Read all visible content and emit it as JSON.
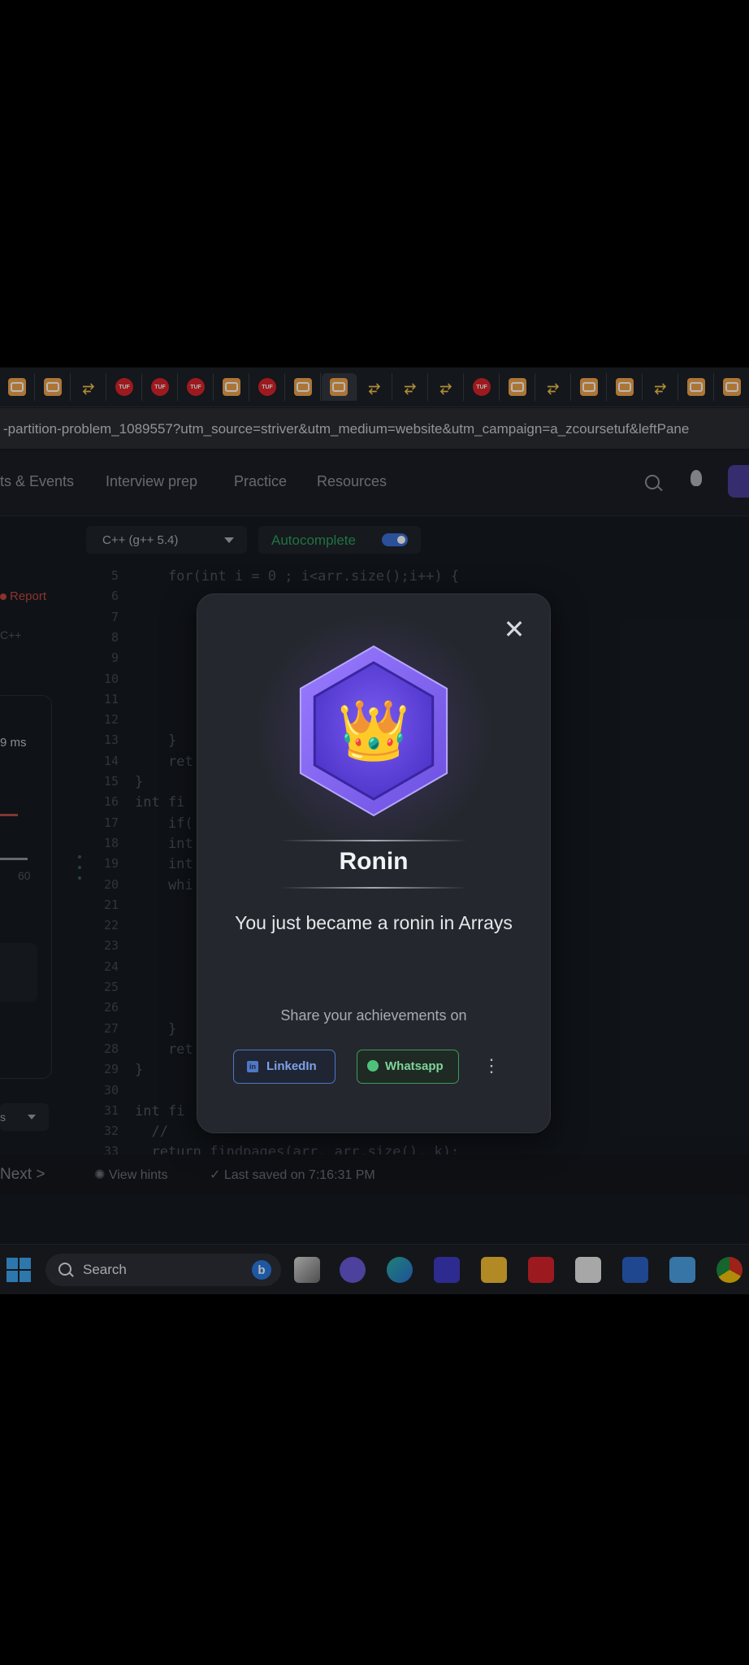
{
  "browser": {
    "tab_favicons": [
      "cc",
      "cc",
      "arrow",
      "tuf",
      "tuf",
      "tuf",
      "cc",
      "tuf",
      "cc",
      "cc",
      "arrow",
      "arrow",
      "arrow",
      "tuf",
      "cc",
      "arrow",
      "cc",
      "cc",
      "arrow",
      "cc",
      "cc"
    ],
    "active_tab_index": 9,
    "url": "-partition-problem_1089557?utm_source=striver&utm_medium=website&utm_campaign=a_zcoursetuf&leftPane"
  },
  "site_nav": {
    "links": [
      "ts & Events",
      "Interview prep",
      "Practice",
      "Resources"
    ]
  },
  "editor": {
    "language": "C++ (g++ 5.4)",
    "autocomplete_label": "Autocomplete",
    "autocomplete_on": true,
    "lines": [
      {
        "n": "5",
        "code": "    for(int i = 0 ; i<arr.size();i++) {"
      },
      {
        "n": "6",
        "code": ""
      },
      {
        "n": "7",
        "code": ""
      },
      {
        "n": "8",
        "code": ""
      },
      {
        "n": "9",
        "code": ""
      },
      {
        "n": "10",
        "code": ""
      },
      {
        "n": "11",
        "code": ""
      },
      {
        "n": "12",
        "code": ""
      },
      {
        "n": "13",
        "code": "    }"
      },
      {
        "n": "14",
        "code": "    ret"
      },
      {
        "n": "15",
        "code": "}"
      },
      {
        "n": "16",
        "code": "int fi                              t m ) {"
      },
      {
        "n": "17",
        "code": "    if("
      },
      {
        "n": "18",
        "code": "    int                             .end()) ;"
      },
      {
        "n": "19",
        "code": "    int                             end(),0);"
      },
      {
        "n": "20",
        "code": "    whi"
      },
      {
        "n": "21",
        "code": ""
      },
      {
        "n": "22",
        "code": ""
      },
      {
        "n": "23",
        "code": ""
      },
      {
        "n": "24",
        "code": ""
      },
      {
        "n": "25",
        "code": ""
      },
      {
        "n": "26",
        "code": ""
      },
      {
        "n": "27",
        "code": "    }"
      },
      {
        "n": "28",
        "code": "    ret"
      },
      {
        "n": "29",
        "code": "}"
      },
      {
        "n": "30",
        "code": ""
      },
      {
        "n": "31",
        "code": "int fi                              r, int k) {"
      },
      {
        "n": "32",
        "code": "  //"
      },
      {
        "n": "33",
        "code": "  return findpages(arr, arr.size(), k);"
      },
      {
        "n": "34",
        "code": "}"
      }
    ]
  },
  "left_panel": {
    "report": "Report",
    "language": "C++",
    "runtime": "9 ms",
    "value": "60",
    "select_label": "s"
  },
  "bottom": {
    "next": "Next >",
    "hints": "View hints",
    "saved": "Last saved on 7:16:31 PM"
  },
  "taskbar": {
    "search_label": "Search"
  },
  "modal": {
    "badge_icon": "crown-icon",
    "badge_glyph": "👑",
    "badge_name": "Ronin",
    "message": "You just became a ronin in Arrays",
    "share_label": "Share your achievements on",
    "linkedin_label": "LinkedIn",
    "whatsapp_label": "Whatsapp",
    "close_glyph": "✕",
    "more_glyph": "⋮"
  },
  "colors": {
    "badge_outer": "#8a6cf0",
    "badge_inner": "#5a3fd6",
    "accent_green": "#3f9a5e",
    "accent_blue": "#4e78c8"
  }
}
